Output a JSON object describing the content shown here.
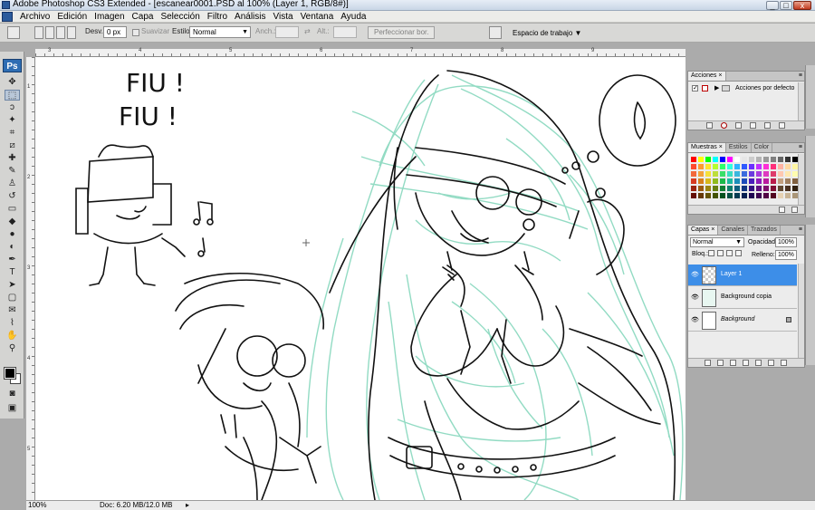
{
  "window": {
    "title": "Adobe Photoshop CS3 Extended - [escanear0001.PSD al 100% (Layer 1, RGB/8#)]",
    "minimize_glyph": "_",
    "maximize_glyph": "□",
    "close_glyph": "x"
  },
  "menu": [
    "Archivo",
    "Edición",
    "Imagen",
    "Capa",
    "Selección",
    "Filtro",
    "Análisis",
    "Vista",
    "Ventana",
    "Ayuda"
  ],
  "options": {
    "desvan_label": "Desv.:",
    "desvan_value": "0 px",
    "suavizar_label": "Suavizar",
    "estilo_label": "Estilo:",
    "estilo_value": "Normal",
    "anch_label": "Anch.:",
    "alt_label": "Alt.:",
    "perfeccionar_label": "Perfeccionar bor.",
    "workspace_label": "Espacio de trabajo"
  },
  "toolbox": {
    "logo": "Ps",
    "tools": [
      {
        "name": "move-tool",
        "glyph": "✥"
      },
      {
        "name": "marquee-tool",
        "glyph": "⬚"
      },
      {
        "name": "lasso-tool",
        "glyph": "ↄ"
      },
      {
        "name": "magic-wand-tool",
        "glyph": "✦"
      },
      {
        "name": "crop-tool",
        "glyph": "⌗"
      },
      {
        "name": "slice-tool",
        "glyph": "⧄"
      },
      {
        "name": "healing-brush-tool",
        "glyph": "✚"
      },
      {
        "name": "brush-tool",
        "glyph": "✎"
      },
      {
        "name": "clone-stamp-tool",
        "glyph": "♙"
      },
      {
        "name": "history-brush-tool",
        "glyph": "↺"
      },
      {
        "name": "eraser-tool",
        "glyph": "▭"
      },
      {
        "name": "paint-bucket-tool",
        "glyph": "◆"
      },
      {
        "name": "blur-tool",
        "glyph": "●"
      },
      {
        "name": "dodge-tool",
        "glyph": "◐"
      },
      {
        "name": "pen-tool",
        "glyph": "✒"
      },
      {
        "name": "type-tool",
        "glyph": "T"
      },
      {
        "name": "path-selection-tool",
        "glyph": "➤"
      },
      {
        "name": "shape-tool",
        "glyph": "▢"
      },
      {
        "name": "notes-tool",
        "glyph": "✉"
      },
      {
        "name": "eyedropper-tool",
        "glyph": "⌇"
      },
      {
        "name": "hand-tool",
        "glyph": "✋"
      },
      {
        "name": "zoom-tool",
        "glyph": "⚲"
      }
    ]
  },
  "canvas": {
    "text_lines": [
      "FIU !",
      "FIU !"
    ]
  },
  "status": {
    "zoom": "100%",
    "doc": "Doc: 6.20 MB/12.0 MB",
    "arrow": "▸"
  },
  "actions_panel": {
    "tab": "Acciones",
    "close": "×",
    "menu": "≡",
    "check": "✓",
    "set_name": "Acciones por defecto"
  },
  "swatches_panel": {
    "tabs": [
      "Muestras",
      "Estilos",
      "Color"
    ],
    "close": "×",
    "menu": "≡",
    "colors": [
      "#ff0000",
      "#ffff00",
      "#00ff00",
      "#00ffff",
      "#0000ff",
      "#ff00ff",
      "#ffffff",
      "#e6e6e6",
      "#cccccc",
      "#b3b3b3",
      "#999999",
      "#808080",
      "#666666",
      "#333333",
      "#000000",
      "#ff4a2f",
      "#ff9a2f",
      "#ffe22f",
      "#b4ff2f",
      "#2fff6b",
      "#2fffe0",
      "#2fb4ff",
      "#2f5aff",
      "#6b2fff",
      "#c22fff",
      "#ff2fd6",
      "#ff2f7a",
      "#ffb4a3",
      "#ffd9a3",
      "#fff6a3",
      "#f2683b",
      "#f3a23b",
      "#f6e03b",
      "#bdde3b",
      "#3bde68",
      "#3bdec0",
      "#3bb7de",
      "#3b6bde",
      "#6b3bde",
      "#a93bde",
      "#de3bc0",
      "#de3b6b",
      "#ffc8b0",
      "#ffe8b0",
      "#fffcb0",
      "#d63a20",
      "#d7801c",
      "#d8b91c",
      "#8fba1c",
      "#1cba4b",
      "#1cba9e",
      "#1c8fba",
      "#1c4bba",
      "#4b1cba",
      "#8f1cba",
      "#ba1c9e",
      "#ba1c4b",
      "#c2a080",
      "#a08060",
      "#806040",
      "#9a2410",
      "#9a5a10",
      "#9a8410",
      "#667f10",
      "#107f34",
      "#107f6b",
      "#10607f",
      "#10347f",
      "#34107f",
      "#60107f",
      "#7f106b",
      "#7f1034",
      "#604830",
      "#483020",
      "#302010",
      "#640f05",
      "#643805",
      "#645405",
      "#435205",
      "#05521f",
      "#055245",
      "#053c52",
      "#051f52",
      "#1f0552",
      "#3c0552",
      "#520545",
      "#52051f",
      "#e6d2b4",
      "#c8b496",
      "#aa9678"
    ]
  },
  "layers_panel": {
    "tabs": [
      "Capas",
      "Canales",
      "Trazados"
    ],
    "close": "×",
    "menu": "≡",
    "blend_mode": "Normal",
    "opacity_label": "Opacidad:",
    "opacity_value": "100%",
    "lock_label": "Bloq.:",
    "fill_label": "Relleno:",
    "fill_value": "100%",
    "eye_glyph": "👁",
    "layers": [
      {
        "name": "Layer 1",
        "selected": true
      },
      {
        "name": "Background copia",
        "selected": false
      },
      {
        "name": "Background",
        "selected": false
      }
    ]
  },
  "colors": {
    "sketch_ink": "#111111",
    "sketch_teal": "#6ecfb0",
    "selection_blue": "#3d8ee8"
  }
}
